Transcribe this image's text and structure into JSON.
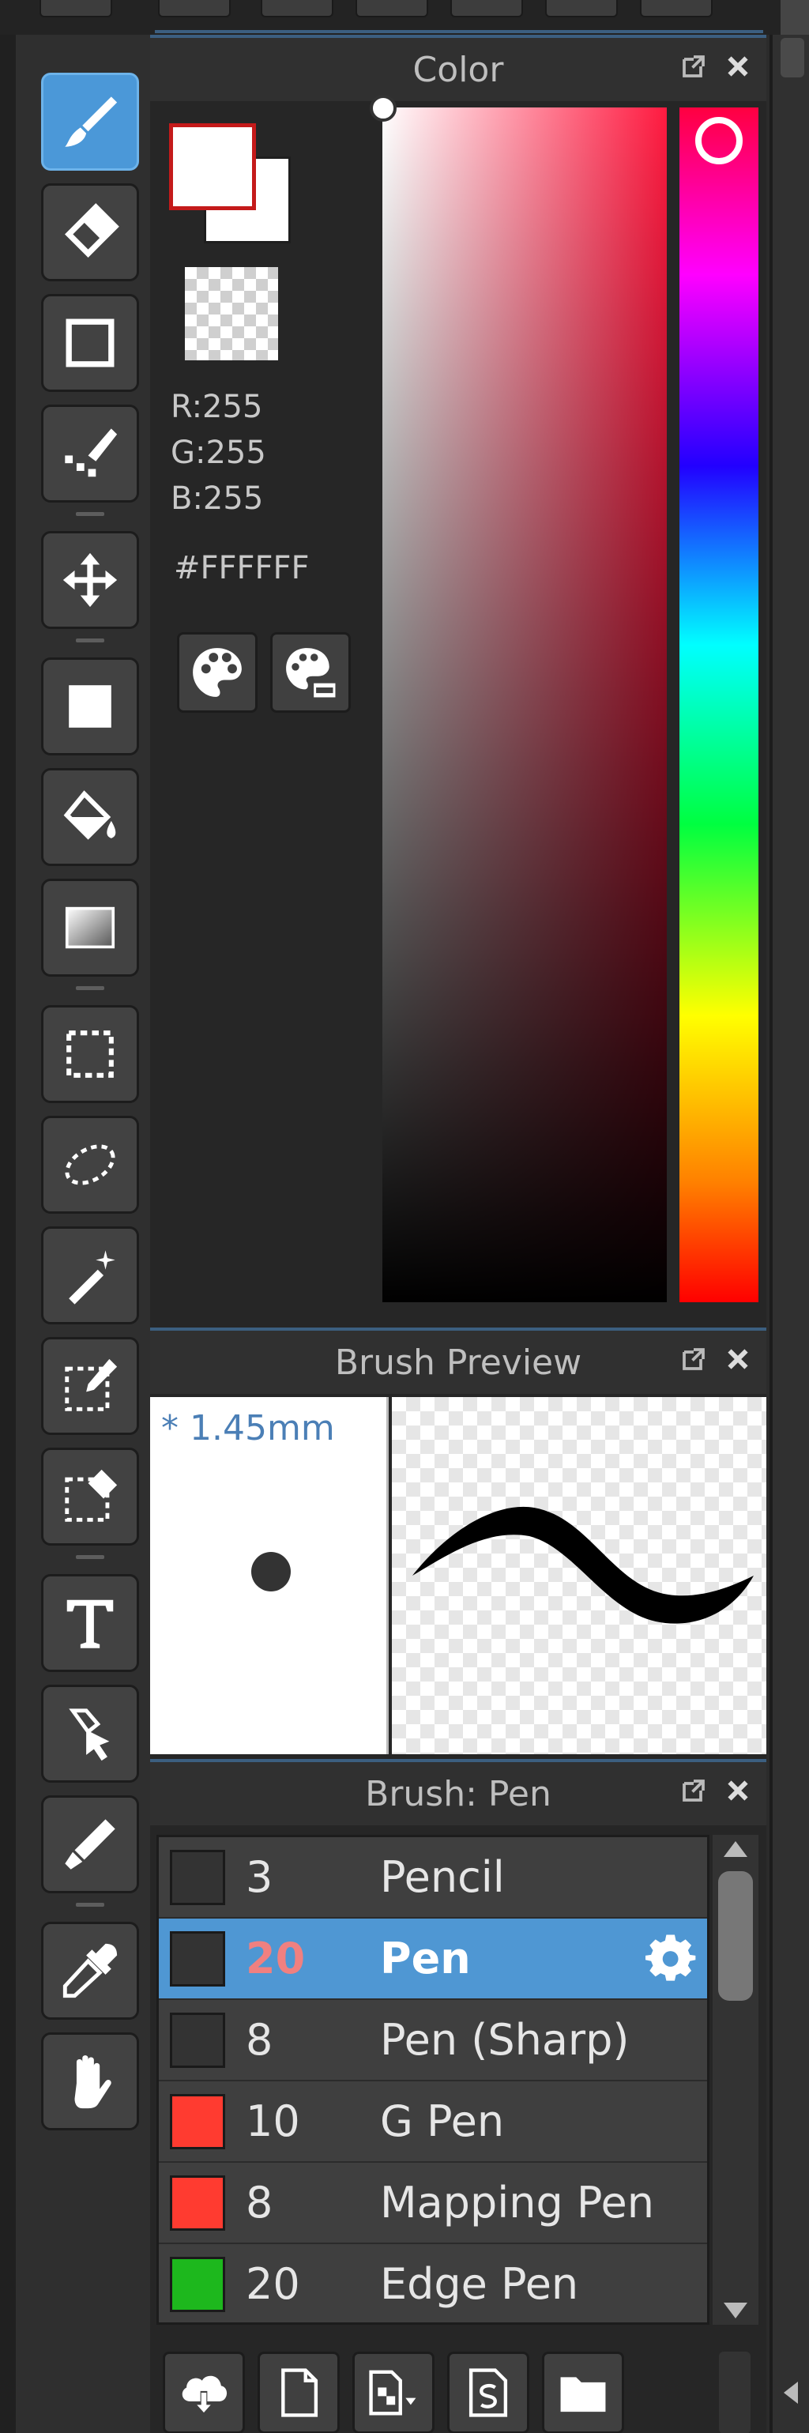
{
  "color_panel": {
    "title": "Color",
    "r_text": "R:255",
    "g_text": "G:255",
    "b_text": "B:255",
    "hex_text": "#FFFFFF",
    "foreground_color": "#FFFFFF",
    "background_color": "#FFFFFF"
  },
  "preview_panel": {
    "title": "Brush Preview",
    "size_label": "* 1.45mm"
  },
  "brush_panel": {
    "title": "Brush: Pen",
    "brushes": [
      {
        "size": "3",
        "name": "Pencil",
        "color": "#333333",
        "selected": false
      },
      {
        "size": "20",
        "name": "Pen",
        "color": "#333333",
        "selected": true
      },
      {
        "size": "8",
        "name": "Pen (Sharp)",
        "color": "#333333",
        "selected": false
      },
      {
        "size": "10",
        "name": "G Pen",
        "color": "#FF3B30",
        "selected": false
      },
      {
        "size": "8",
        "name": "Mapping Pen",
        "color": "#FF3B30",
        "selected": false
      },
      {
        "size": "20",
        "name": "Edge Pen",
        "color": "#1DB81D",
        "selected": false
      }
    ]
  },
  "toolbar": {
    "active_tool": "brush-tool",
    "tools": [
      "brush-tool",
      "eraser-tool",
      "shape-tool",
      "correction-tool",
      "move-tool",
      "fill-tool",
      "bucket-tool",
      "gradient-tool",
      "rect-select-tool",
      "lasso-select-tool",
      "magic-wand-tool",
      "select-pen-tool",
      "select-eraser-tool",
      "text-tool",
      "operation-tool",
      "blur-tool",
      "eyedropper-tool",
      "hand-tool"
    ]
  },
  "theme": {
    "accent": "#4F97D3",
    "panel_bg": "#262626",
    "header_bg": "#303030",
    "highlight_red": "#C41A1A"
  }
}
